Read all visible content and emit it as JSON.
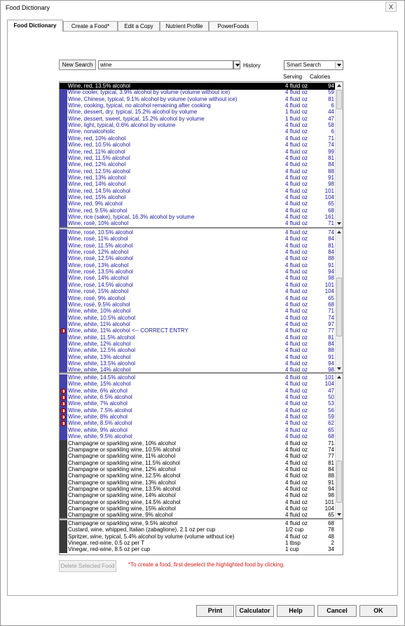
{
  "window": {
    "title": "Food Dictionary",
    "close_label": "X"
  },
  "tabs": [
    {
      "label": "Food Dictionary"
    },
    {
      "label": "Create a Food*"
    },
    {
      "label": "Edit a Copy"
    },
    {
      "label": "Nutrient Profile"
    },
    {
      "label": "PowerFoods"
    }
  ],
  "search": {
    "new_search_label": "New Search",
    "value": "wine",
    "history_label": "History",
    "mode": "Smart Search"
  },
  "columns": {
    "serving": "Serving",
    "calories": "Calories"
  },
  "lists": [
    {
      "rows": [
        {
          "name": "Wine, red, 13.5% alcohol",
          "serving": "4 fluid oz",
          "calories": "94",
          "selected": true,
          "style": "sel"
        },
        {
          "name": "Wine cooler, typical, 3.9% alcohol by volume (volume without ice)",
          "serving": "4 fluid oz",
          "calories": "59",
          "style": "blue"
        },
        {
          "name": "Wine, Chinese, typical, 9.1% alcohol by volume (volume without ice)",
          "serving": "4 fluid oz",
          "calories": "81",
          "style": "blue"
        },
        {
          "name": "Wine, cooking, typical, no alcohol remaining after cooking",
          "serving": "4 fluid oz",
          "calories": "6",
          "style": "blue"
        },
        {
          "name": "Wine, dessert, dry, typical, 15.2% alcohol by volume",
          "serving": "1 fluid oz",
          "calories": "44",
          "style": "blue"
        },
        {
          "name": "Wine, dessert, sweet, typical, 15.2% alcohol by volume",
          "serving": "1 fluid oz",
          "calories": "47",
          "style": "blue"
        },
        {
          "name": "Wine, light, typical, 0.6% alcohol by volume",
          "serving": "4 fluid oz",
          "calories": "58",
          "style": "blue"
        },
        {
          "name": "Wine, nonalcoholic",
          "serving": "4 fluid oz",
          "calories": "6",
          "style": "blue"
        },
        {
          "name": "Wine, red, 10% alcohol",
          "serving": "4 fluid oz",
          "calories": "71",
          "style": "blue"
        },
        {
          "name": "Wine, red, 10.5% alcohol",
          "serving": "4 fluid oz",
          "calories": "74",
          "style": "blue"
        },
        {
          "name": "Wine, red, 11% alcohol",
          "serving": "4 fluid oz",
          "calories": "99",
          "style": "blue"
        },
        {
          "name": "Wine, red, 11.5% alcohol",
          "serving": "4 fluid oz",
          "calories": "81",
          "style": "blue"
        },
        {
          "name": "Wine, red, 12% alcohol",
          "serving": "4 fluid oz",
          "calories": "84",
          "style": "blue"
        },
        {
          "name": "Wine, red, 12.5% alcohol",
          "serving": "4 fluid oz",
          "calories": "88",
          "style": "blue"
        },
        {
          "name": "Wine, red, 13% alcohol",
          "serving": "4 fluid oz",
          "calories": "91",
          "style": "blue"
        },
        {
          "name": "Wine, red, 14% alcohol",
          "serving": "4 fluid oz",
          "calories": "98",
          "style": "blue"
        },
        {
          "name": "Wine, red, 14.5% alcohol",
          "serving": "4 fluid oz",
          "calories": "101",
          "style": "blue"
        },
        {
          "name": "Wine, red, 15% alcohol",
          "serving": "4 fluid oz",
          "calories": "104",
          "style": "blue"
        },
        {
          "name": "Wine, red, 9% alcohol",
          "serving": "4 fluid oz",
          "calories": "65",
          "style": "blue"
        },
        {
          "name": "Wine, red, 9.5% alcohol",
          "serving": "4 fluid oz",
          "calories": "68",
          "style": "blue"
        },
        {
          "name": "Wine, rice (sake), typical, 16.3% alcohol by volume",
          "serving": "4 fluid oz",
          "calories": "161",
          "style": "blue"
        },
        {
          "name": "Wine, rosé, 10% alcohol",
          "serving": "4 fluid oz",
          "calories": "71",
          "style": "blue"
        }
      ]
    },
    {
      "rows": [
        {
          "name": "Wine, rosé, 10.5% alcohol",
          "serving": "4 fluid oz",
          "calories": "74",
          "style": "blue"
        },
        {
          "name": "Wine, rosé, 11% alcohol",
          "serving": "4 fluid oz",
          "calories": "84",
          "style": "blue"
        },
        {
          "name": "Wine, rosé, 11.5% alcohol",
          "serving": "4 fluid oz",
          "calories": "81",
          "style": "blue"
        },
        {
          "name": "Wine, rosé, 12% alcohol",
          "serving": "4 fluid oz",
          "calories": "84",
          "style": "blue"
        },
        {
          "name": "Wine, rosé, 12.5% alcohol",
          "serving": "4 fluid oz",
          "calories": "88",
          "style": "blue"
        },
        {
          "name": "Wine, rosé, 13% alcohol",
          "serving": "4 fluid oz",
          "calories": "91",
          "style": "blue"
        },
        {
          "name": "Wine, rosé, 13.5% alcohol",
          "serving": "4 fluid oz",
          "calories": "94",
          "style": "blue"
        },
        {
          "name": "Wine, rosé, 14% alcohol",
          "serving": "4 fluid oz",
          "calories": "98",
          "style": "blue"
        },
        {
          "name": "Wine, rosé, 14.5% alcohol",
          "serving": "4 fluid oz",
          "calories": "101",
          "style": "blue"
        },
        {
          "name": "Wine, rosé, 15% alcohol",
          "serving": "4 fluid oz",
          "calories": "104",
          "style": "blue"
        },
        {
          "name": "Wine, rosé, 9% alcohol",
          "serving": "4 fluid oz",
          "calories": "65",
          "style": "blue"
        },
        {
          "name": "Wine, rosé, 9.5% alcohol",
          "serving": "4 fluid oz",
          "calories": "68",
          "style": "blue"
        },
        {
          "name": "Wine, white, 10% alcohol",
          "serving": "4 fluid oz",
          "calories": "71",
          "style": "blue"
        },
        {
          "name": "Wine, white, 10.5% alcohol",
          "serving": "4 fluid oz",
          "calories": "74",
          "style": "blue"
        },
        {
          "name": "Wine, white, 11% alcohol",
          "serving": "4 fluid oz",
          "calories": "97",
          "style": "blue"
        },
        {
          "name": "Wine, white, 11% alcohol <-- CORRECT ENTRY",
          "serving": "4 fluid oz",
          "calories": "77",
          "style": "blue",
          "flag": true
        },
        {
          "name": "Wine, white, 11.5% alcohol",
          "serving": "4 fluid oz",
          "calories": "81",
          "style": "blue"
        },
        {
          "name": "Wine, white, 12% alcohol",
          "serving": "4 fluid oz",
          "calories": "84",
          "style": "blue"
        },
        {
          "name": "Wine, white, 12.5% alcohol",
          "serving": "4 fluid oz",
          "calories": "88",
          "style": "blue"
        },
        {
          "name": "Wine, white, 13% alcohol",
          "serving": "4 fluid oz",
          "calories": "91",
          "style": "blue"
        },
        {
          "name": "Wine, white, 13.5% alcohol",
          "serving": "4 fluid oz",
          "calories": "94",
          "style": "blue"
        },
        {
          "name": "Wine, white, 14% alcohol",
          "serving": "4 fluid oz",
          "calories": "98",
          "style": "blue"
        }
      ]
    },
    {
      "rows": [
        {
          "name": "Wine, white, 14.5% alcohol",
          "serving": "4 fluid oz",
          "calories": "101",
          "style": "blue"
        },
        {
          "name": "Wine, white, 15% alcohol",
          "serving": "4 fluid oz",
          "calories": "104",
          "style": "blue"
        },
        {
          "name": "Wine, white, 6% alcohol",
          "serving": "4 fluid oz",
          "calories": "47",
          "style": "blue",
          "flag": true
        },
        {
          "name": "Wine, white, 6.5% alcohol",
          "serving": "4 fluid oz",
          "calories": "50",
          "style": "blue",
          "flag": true
        },
        {
          "name": "Wine, white, 7% alcohol",
          "serving": "4 fluid oz",
          "calories": "53",
          "style": "blue",
          "flag": true
        },
        {
          "name": "Wine, white, 7.5% alcohol",
          "serving": "4 fluid oz",
          "calories": "56",
          "style": "blue",
          "flag": true
        },
        {
          "name": "Wine, white, 8% alcohol",
          "serving": "4 fluid oz",
          "calories": "59",
          "style": "blue",
          "flag": true
        },
        {
          "name": "Wine, white, 8.5% alcohol",
          "serving": "4 fluid oz",
          "calories": "62",
          "style": "blue",
          "flag": true
        },
        {
          "name": "Wine, white, 9% alcohol",
          "serving": "4 fluid oz",
          "calories": "65",
          "style": "blue"
        },
        {
          "name": "Wine, white, 9.5% alcohol",
          "serving": "4 fluid oz",
          "calories": "68",
          "style": "blue"
        },
        {
          "name": "Champagne or sparkling wine, 10% alcohol",
          "serving": "4 fluid oz",
          "calories": "71",
          "style": "black"
        },
        {
          "name": "Champagne or sparkling wine, 10.5% alcohol",
          "serving": "4 fluid oz",
          "calories": "74",
          "style": "black"
        },
        {
          "name": "Champagne or sparkling wine, 11% alcohol",
          "serving": "4 fluid oz",
          "calories": "77",
          "style": "black"
        },
        {
          "name": "Champagne or sparkling wine, 11.5% alcohol",
          "serving": "4 fluid oz",
          "calories": "81",
          "style": "black"
        },
        {
          "name": "Champagne or sparkling wine, 12% alcohol",
          "serving": "4 fluid oz",
          "calories": "84",
          "style": "black"
        },
        {
          "name": "Champagne or sparkling wine, 12.5% alcohol",
          "serving": "4 fluid oz",
          "calories": "88",
          "style": "black"
        },
        {
          "name": "Champagne or sparkling wine, 13% alcohol",
          "serving": "4 fluid oz",
          "calories": "91",
          "style": "black"
        },
        {
          "name": "Champagne or sparkling wine, 13.5% alcohol",
          "serving": "4 fluid oz",
          "calories": "94",
          "style": "black"
        },
        {
          "name": "Champagne or sparkling wine, 14% alcohol",
          "serving": "4 fluid oz",
          "calories": "98",
          "style": "black"
        },
        {
          "name": "Champagne or sparkling wine, 14.5% alcohol",
          "serving": "4 fluid oz",
          "calories": "101",
          "style": "black"
        },
        {
          "name": "Champagne or sparkling wine, 15% alcohol",
          "serving": "4 fluid oz",
          "calories": "104",
          "style": "black"
        },
        {
          "name": "Champagne or sparkling wine, 9% alcohol",
          "serving": "4 fluid oz",
          "calories": "65",
          "style": "black"
        }
      ]
    },
    {
      "rows": [
        {
          "name": "Champagne or sparkling wine, 9.5% alcohol",
          "serving": "4 fluid oz",
          "calories": "68",
          "style": "black"
        },
        {
          "name": "Custard, wine, whipped, Italian (zabaglione), 2.1 oz per cup",
          "serving": "1/2 cup",
          "calories": "78",
          "style": "black"
        },
        {
          "name": "Spritzer, wine, typical, 5.4% alcohol by volume (volume without ice)",
          "serving": "4 fluid oz",
          "calories": "48",
          "style": "black"
        },
        {
          "name": "Vinegar, red-wine, 0.5 oz per T",
          "serving": "1 tbsp",
          "calories": "2",
          "style": "black"
        },
        {
          "name": "Vinegar, red-wine, 8.5 oz per cup",
          "serving": "1 cup",
          "calories": "34",
          "style": "black"
        }
      ]
    }
  ],
  "footer": {
    "delete_label": "Delete Selected Food",
    "hint": "*To create a food, first deselect the highlighted food by clicking.",
    "print": "Print",
    "calculator": "Calculator",
    "help": "Help",
    "cancel": "Cancel",
    "ok": "OK"
  }
}
